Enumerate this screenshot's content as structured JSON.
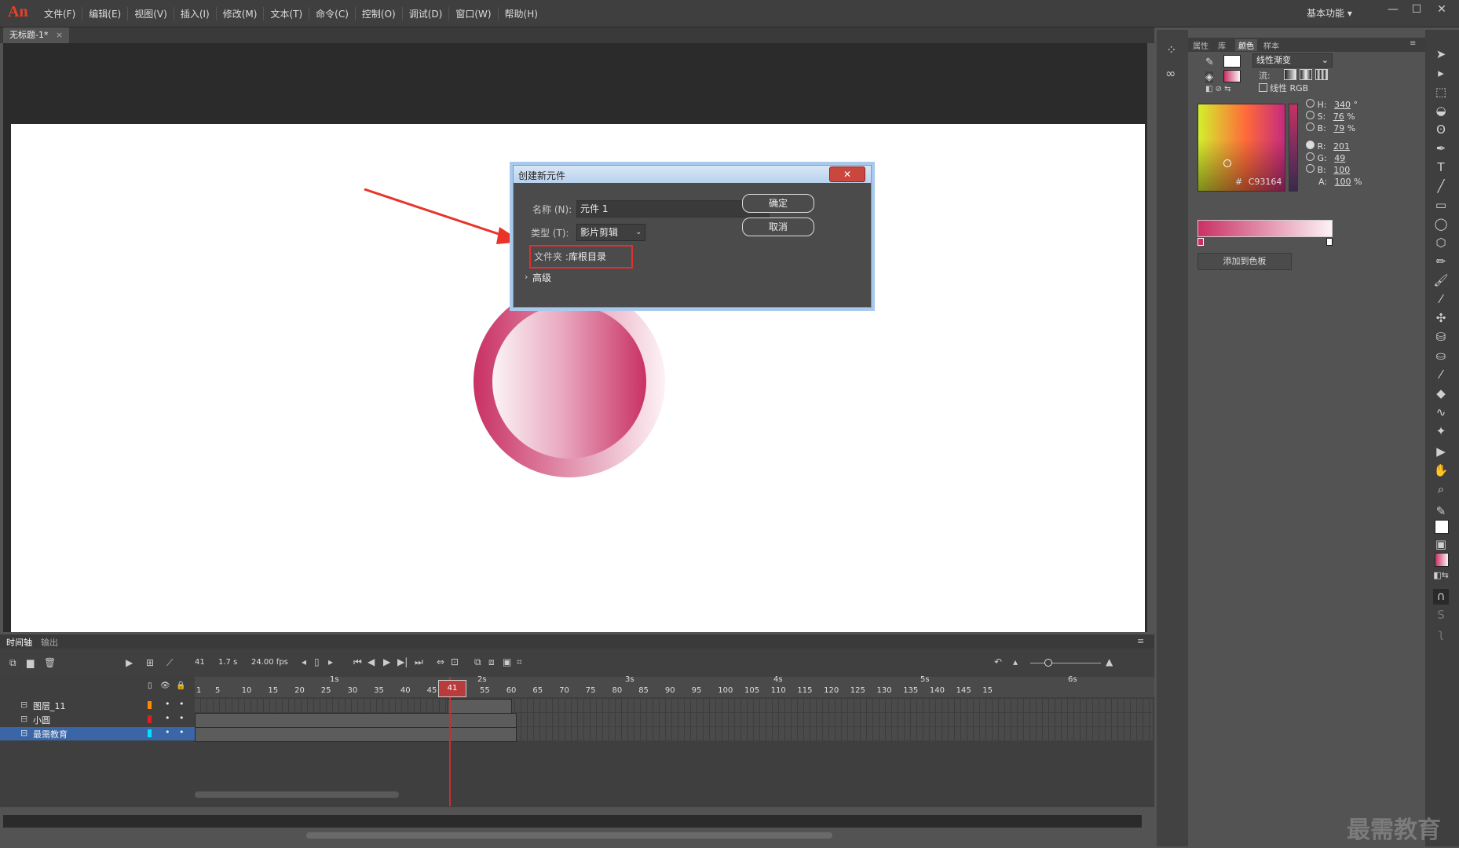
{
  "app": {
    "logo": "An",
    "workspace": "基本功能 ▾"
  },
  "menu": [
    "文件(F)",
    "编辑(E)",
    "视图(V)",
    "插入(I)",
    "修改(M)",
    "文本(T)",
    "命令(C)",
    "控制(O)",
    "调试(D)",
    "窗口(W)",
    "帮助(H)"
  ],
  "document": {
    "tab": "无标题-1*",
    "tab_close": "×"
  },
  "dialog": {
    "title": "创建新元件",
    "close": "✕",
    "name_label": "名称 (N):",
    "name_value": "元件 1",
    "type_label": "类型 (T):",
    "type_value": "影片剪辑",
    "folder_label": "文件夹 :",
    "folder_value": "库根目录",
    "advanced": "高级",
    "ok": "确定",
    "cancel": "取消"
  },
  "properties": {
    "tabs": [
      "属性",
      "库",
      "颜色",
      "样本"
    ],
    "gradient_type": "线性渐变",
    "flow_label": "流:",
    "linear_rgb": "线性 RGB",
    "hsb": [
      {
        "label": "H:",
        "value": "340",
        "unit": "°"
      },
      {
        "label": "S:",
        "value": "76",
        "unit": "%"
      },
      {
        "label": "B:",
        "value": "79",
        "unit": "%"
      }
    ],
    "rgb": [
      {
        "label": "R:",
        "value": "201"
      },
      {
        "label": "G:",
        "value": "49"
      },
      {
        "label": "B:",
        "value": "100"
      }
    ],
    "alpha": {
      "label": "A:",
      "value": "100",
      "unit": "%"
    },
    "hex_label": "#",
    "hex": "C93164",
    "add_swatch": "添加到色板"
  },
  "timeline": {
    "tabs": [
      "时间轴",
      "输出"
    ],
    "current_frame": "41",
    "time": "1.7 s",
    "fps": "24.00 fps",
    "seconds": [
      "1s",
      "2s",
      "3s",
      "4s",
      "5s",
      "6s"
    ],
    "frame_numbers": [
      "1",
      "5",
      "10",
      "15",
      "20",
      "25",
      "30",
      "35",
      "40",
      "45",
      "50",
      "55",
      "60",
      "65",
      "70",
      "75",
      "80",
      "85",
      "90",
      "95",
      "100",
      "105",
      "110",
      "115",
      "120",
      "125",
      "130",
      "135",
      "140",
      "145",
      "15"
    ],
    "playhead_frame": "41",
    "layers": [
      {
        "name": "图层_11",
        "color": "#ff8a00"
      },
      {
        "name": "小圆",
        "color": "#e02020"
      },
      {
        "name": "最需教育",
        "color": "#00e5ff"
      }
    ]
  },
  "colors": {
    "accent": "#c93164",
    "highlight": "#e03030"
  },
  "watermark": "最需教育"
}
